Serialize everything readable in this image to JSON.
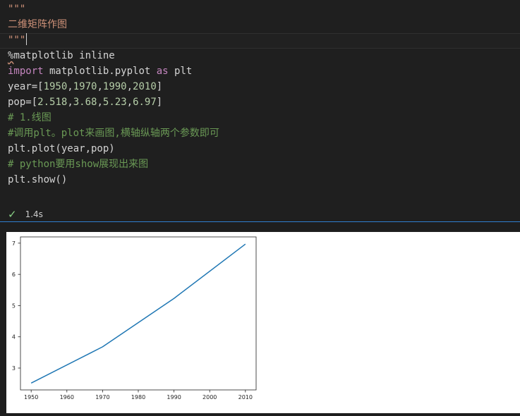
{
  "code": {
    "lines": [
      [
        {
          "t": "\"\"\"",
          "c": "str"
        }
      ],
      [
        {
          "t": "二维矩阵作图",
          "c": "str"
        }
      ],
      [
        {
          "t": "\"\"\"",
          "c": "str",
          "caret": true
        }
      ],
      [
        {
          "t": "%",
          "c": "magic",
          "squiggle": true
        },
        {
          "t": "matplotlib inline",
          "c": "fn"
        }
      ],
      [
        {
          "t": "import",
          "c": "kw"
        },
        {
          "t": " matplotlib.pyplot ",
          "c": "fn"
        },
        {
          "t": "as",
          "c": "kw"
        },
        {
          "t": " plt",
          "c": "fn"
        }
      ],
      [
        {
          "t": "year=[",
          "c": "fn"
        },
        {
          "t": "1950",
          "c": "num"
        },
        {
          "t": ",",
          "c": "fn"
        },
        {
          "t": "1970",
          "c": "num"
        },
        {
          "t": ",",
          "c": "fn"
        },
        {
          "t": "1990",
          "c": "num"
        },
        {
          "t": ",",
          "c": "fn"
        },
        {
          "t": "2010",
          "c": "num"
        },
        {
          "t": "]",
          "c": "fn"
        }
      ],
      [
        {
          "t": "pop=[",
          "c": "fn"
        },
        {
          "t": "2.518",
          "c": "num"
        },
        {
          "t": ",",
          "c": "fn"
        },
        {
          "t": "3.68",
          "c": "num"
        },
        {
          "t": ",",
          "c": "fn"
        },
        {
          "t": "5.23",
          "c": "num"
        },
        {
          "t": ",",
          "c": "fn"
        },
        {
          "t": "6.97",
          "c": "num"
        },
        {
          "t": "]",
          "c": "fn"
        }
      ],
      [
        {
          "t": "# 1.线图",
          "c": "com"
        }
      ],
      [
        {
          "t": "#调用plt。plot来画图,横轴纵轴两个参数即可",
          "c": "com"
        }
      ],
      [
        {
          "t": "plt.plot(year,pop)",
          "c": "fn"
        }
      ],
      [
        {
          "t": "# python要用show展现出来图",
          "c": "com"
        }
      ],
      [
        {
          "t": "plt.show()",
          "c": "fn"
        }
      ]
    ]
  },
  "status": {
    "icon": "check-icon",
    "duration": "1.4s",
    "color": "#89d185"
  },
  "chart_data": {
    "type": "line",
    "x": [
      1950,
      1970,
      1990,
      2010
    ],
    "series": [
      {
        "values": [
          2.518,
          3.68,
          5.23,
          6.97
        ],
        "color": "#1f77b4"
      }
    ],
    "xticks": [
      "1950",
      "1960",
      "1970",
      "1980",
      "1990",
      "2000",
      "2010"
    ],
    "yticks": [
      "3",
      "4",
      "5",
      "6",
      "7"
    ],
    "xlim": [
      1947,
      2013
    ],
    "ylim": [
      2.3,
      7.2
    ],
    "title": "",
    "xlabel": "",
    "ylabel": "",
    "grid": false
  }
}
